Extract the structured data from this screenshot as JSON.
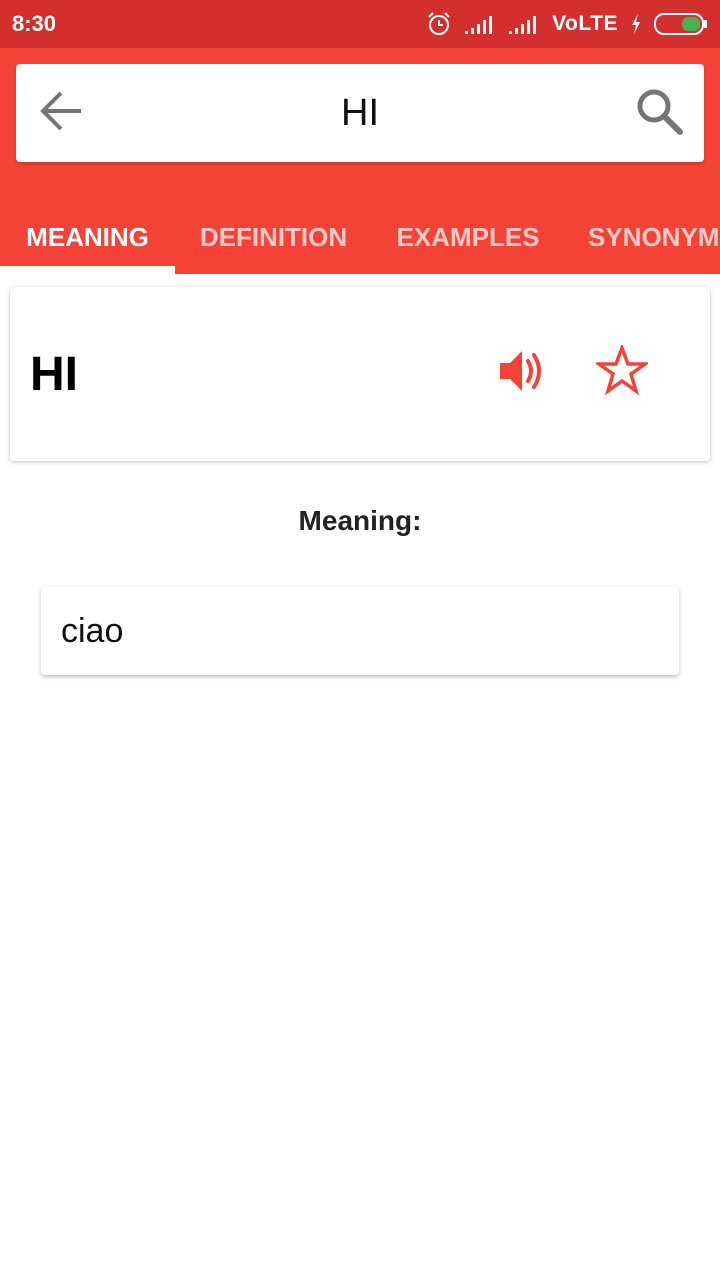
{
  "status_bar": {
    "time": "8:30",
    "network_label": "VoLTE",
    "icons": [
      "alarm-icon",
      "signal-icon",
      "signal-icon",
      "charging-icon",
      "battery-icon"
    ]
  },
  "search": {
    "query": "HI",
    "icons": [
      "back-arrow-icon",
      "search-icon"
    ]
  },
  "tabs": [
    {
      "label": "MEANING",
      "active": true
    },
    {
      "label": "DEFINITION",
      "active": false
    },
    {
      "label": "EXAMPLES",
      "active": false
    },
    {
      "label": "SYNONYMS",
      "active": false
    }
  ],
  "word_card": {
    "word": "HI",
    "icons": [
      "speaker-icon",
      "star-outline-icon"
    ]
  },
  "meaning": {
    "label": "Meaning:",
    "value": "ciao"
  },
  "colors": {
    "status_bar": "#d32f2f",
    "primary": "#f44336",
    "accent": "#f44336",
    "battery_green": "#4caf50"
  }
}
